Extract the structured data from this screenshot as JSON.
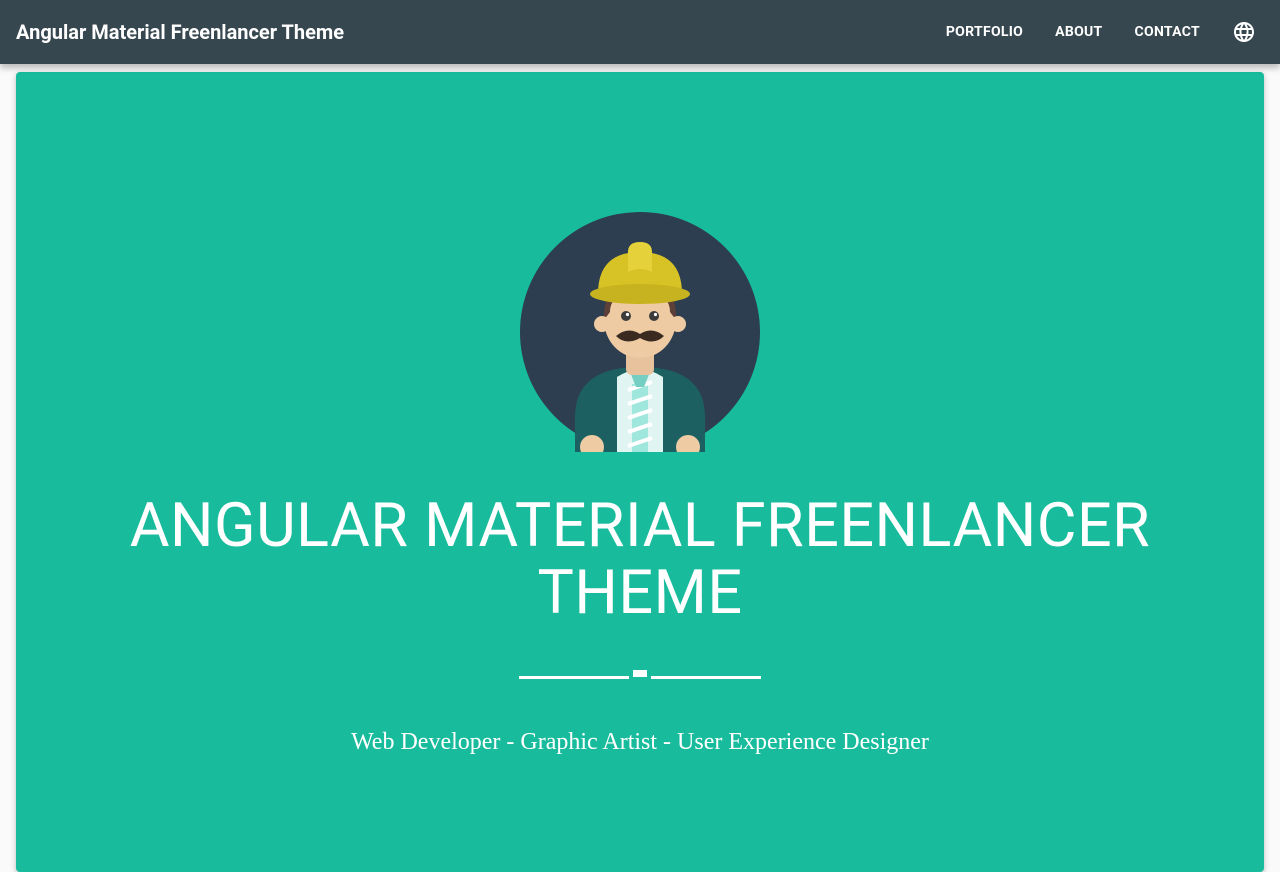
{
  "toolbar": {
    "title": "Angular Material Freenlancer Theme",
    "nav": {
      "portfolio": "PORTFOLIO",
      "about": "ABOUT",
      "contact": "CONTACT"
    }
  },
  "hero": {
    "title": "ANGULAR MATERIAL FREENLANCER THEME",
    "subtitle": "Web Developer - Graphic Artist - User Experience Designer"
  },
  "colors": {
    "toolbar_bg": "#37474f",
    "hero_bg": "#18bc9c"
  }
}
